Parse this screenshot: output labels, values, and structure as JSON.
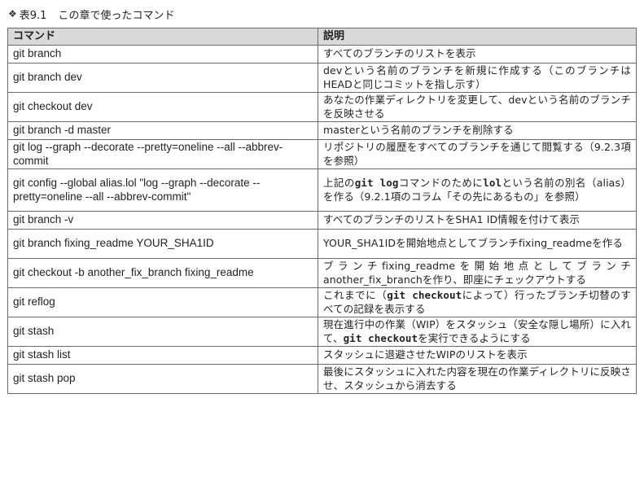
{
  "caption": {
    "mark": "❖",
    "number": "表9.1",
    "title": "この章で使ったコマンド"
  },
  "table": {
    "headers": [
      "コマンド",
      "説明"
    ],
    "rows": [
      {
        "command": "git branch",
        "desc": [
          "すべてのブランチのリストを表示"
        ]
      },
      {
        "command": "git branch dev",
        "desc": [
          "devという名前のブランチを新規に作成する（このブランチはHEADと同じコミットを指し示す）"
        ]
      },
      {
        "command": "git checkout dev",
        "desc": [
          "あなたの作業ディレクトリを変更して、devという名前のブランチを反映させる"
        ]
      },
      {
        "command": "git branch -d master",
        "desc": [
          "masterという名前のブランチを削除する"
        ]
      },
      {
        "command": "git log --graph --decorate --pretty=oneline --all --abbrev-commit",
        "desc": [
          "リポジトリの履歴をすべてのブランチを通じて閲覧する（9.2.3項を参照）"
        ]
      },
      {
        "command": "git config --global alias.lol \"log --graph --decorate --pretty=oneline --all --abbrev-commit\"",
        "desc": [
          "上記の",
          "git log",
          "コマンドのために",
          "lol",
          "という名前の別名（alias）を作る（9.2.1項のコラム「その先にあるもの」を参照）"
        ]
      },
      {
        "command": "git branch -v",
        "desc": [
          "すべてのブランチのリストをSHA1 ID情報を付けて表示"
        ]
      },
      {
        "command": "git branch fixing_readme YOUR_SHA1ID",
        "desc": [
          "YOUR_SHA1IDを開始地点としてブランチfixing_readmeを作る"
        ]
      },
      {
        "command": "git checkout -b another_fix_branch fixing_readme",
        "desc": [
          "ブランチfixing_readmeを開始地点としてブランチanother_fix_branchを作り、即座にチェックアウトする"
        ]
      },
      {
        "command": "git reflog",
        "desc": [
          "これまでに（",
          "git checkout",
          "によって）行ったブランチ切替のすべての記録を表示する"
        ]
      },
      {
        "command": "git stash",
        "desc": [
          "現在進行中の作業（WIP）をスタッシュ（安全な隠し場所）に入れて、",
          "git checkout",
          "を実行できるようにする"
        ]
      },
      {
        "command": "git stash list",
        "desc": [
          "スタッシュに退避させたWIPのリストを表示"
        ]
      },
      {
        "command": "git stash pop",
        "desc": [
          "最後にスタッシュに入れた内容を現在の作業ディレクトリに反映させ、スタッシュから消去する"
        ]
      }
    ]
  }
}
